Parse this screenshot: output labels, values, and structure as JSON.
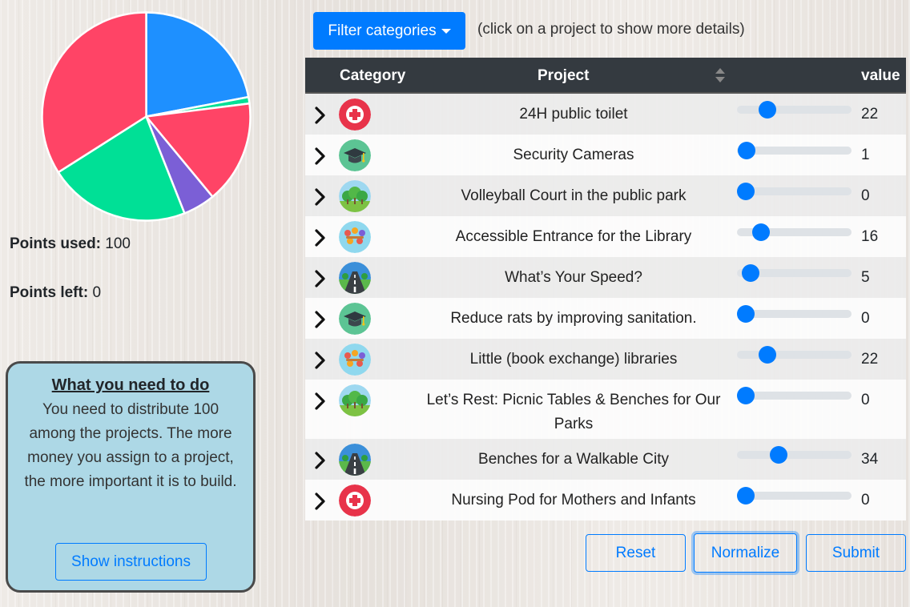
{
  "summary": {
    "points_used_label": "Points used:",
    "points_used_value": "100",
    "points_left_label": "Points left:",
    "points_left_value": "0"
  },
  "instructions": {
    "title": "What you need to do",
    "text": "You need to distribute 100 among the projects. The more money you assign to a project, the more important it is to build.",
    "button_label": "Show instructions"
  },
  "toolbar": {
    "filter_label": "Filter categories",
    "hint": "(click on a project to show more details)"
  },
  "table": {
    "headers": {
      "category": "Category",
      "project": "Project",
      "value": "value"
    },
    "slider_max": 100,
    "rows": [
      {
        "category_icon": "health-icon",
        "project": "24H public toilet",
        "value": 22
      },
      {
        "category_icon": "education-icon",
        "project": "Security Cameras",
        "value": 1
      },
      {
        "category_icon": "park-icon",
        "project": "Volleyball Court in the public park",
        "value": 0
      },
      {
        "category_icon": "community-icon",
        "project": "Accessible Entrance for the Library",
        "value": 16
      },
      {
        "category_icon": "road-icon",
        "project": "What’s Your Speed?",
        "value": 5
      },
      {
        "category_icon": "education-icon",
        "project": "Reduce rats by improving sanitation.",
        "value": 0
      },
      {
        "category_icon": "community-icon",
        "project": "Little (book exchange) libraries",
        "value": 22
      },
      {
        "category_icon": "park-icon",
        "project": "Let’s Rest: Picnic Tables & Benches for Our Parks",
        "value": 0
      },
      {
        "category_icon": "road-icon",
        "project": "Benches for a Walkable City",
        "value": 34
      },
      {
        "category_icon": "health-icon",
        "project": "Nursing Pod for Mothers and Infants",
        "value": 0
      }
    ]
  },
  "actions": {
    "reset": "Reset",
    "normalize": "Normalize",
    "submit": "Submit"
  },
  "chart_data": {
    "type": "pie",
    "values": [
      22,
      1,
      16,
      5,
      22,
      34
    ],
    "colors": [
      "#1e90ff",
      "#00e096",
      "#ff4466",
      "#7b5fd6",
      "#00e096",
      "#ff4466"
    ]
  },
  "colors": {
    "primary": "#007bff",
    "header_bg": "#343a40",
    "instructions_bg": "#add8e6"
  }
}
